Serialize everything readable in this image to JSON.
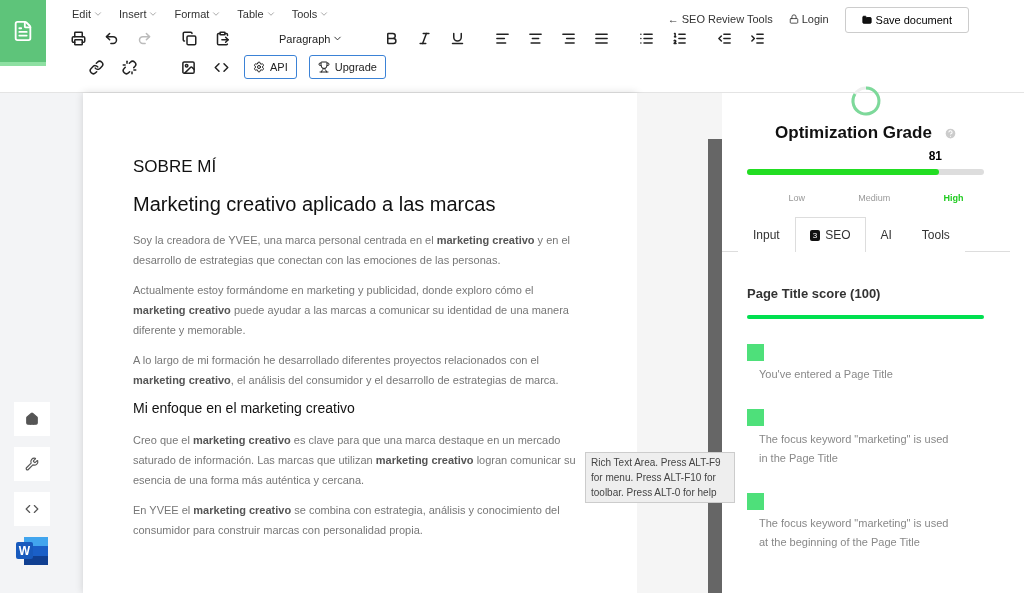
{
  "menus": [
    {
      "label": "Edit"
    },
    {
      "label": "Insert"
    },
    {
      "label": "Format"
    },
    {
      "label": "Table"
    },
    {
      "label": "Tools"
    }
  ],
  "toolbar_row1": [
    {
      "kind": "print",
      "disabled": false
    },
    {
      "kind": "undo",
      "disabled": false
    },
    {
      "kind": "redo",
      "disabled": true
    },
    {
      "kind": "gap"
    },
    {
      "kind": "copy",
      "disabled": false
    },
    {
      "kind": "paste",
      "disabled": false
    },
    {
      "kind": "block",
      "label": "Paragraph"
    },
    {
      "kind": "bold",
      "disabled": false
    },
    {
      "kind": "italic",
      "disabled": false
    },
    {
      "kind": "underline",
      "disabled": false
    },
    {
      "kind": "gap"
    },
    {
      "kind": "align-left",
      "disabled": false
    },
    {
      "kind": "align-center",
      "disabled": false
    },
    {
      "kind": "align-right",
      "disabled": false
    },
    {
      "kind": "align-justify",
      "disabled": false
    },
    {
      "kind": "gap"
    },
    {
      "kind": "bullets",
      "disabled": false
    },
    {
      "kind": "numbers",
      "disabled": false
    },
    {
      "kind": "gap"
    },
    {
      "kind": "outdent",
      "disabled": false
    },
    {
      "kind": "indent",
      "disabled": false
    }
  ],
  "toolbar_row2": [
    {
      "kind": "link",
      "disabled": false
    },
    {
      "kind": "unlink",
      "disabled": false
    },
    {
      "kind": "gap"
    },
    {
      "kind": "image",
      "disabled": false
    },
    {
      "kind": "code",
      "disabled": false
    },
    {
      "kind": "api",
      "label": "API"
    },
    {
      "kind": "upgrade",
      "label": "Upgrade"
    }
  ],
  "top_links": [
    {
      "kind": "back",
      "label": "← SEO Review Tools"
    },
    {
      "kind": "login",
      "label": "Login"
    }
  ],
  "save_button": "Save document",
  "side_buttons": [
    {
      "kind": "home"
    },
    {
      "kind": "wrench"
    },
    {
      "kind": "code"
    },
    {
      "kind": "word",
      "label": "W"
    }
  ],
  "document": [
    {
      "kind": "h3",
      "text": "SOBRE MÍ"
    },
    {
      "kind": "h1",
      "text": "Marketing creativo aplicado a las marcas"
    },
    {
      "kind": "p",
      "text": "Soy la creadora de YVEE, una marca personal centrada en el **marketing creativo** y en el desarrollo de estrategias que conectan con las emociones de las personas."
    },
    {
      "kind": "p",
      "text": "Actualmente estoy formándome en marketing y publicidad, donde exploro cómo el **marketing creativo** puede ayudar a las marcas a comunicar su identidad de una manera diferente y memorable."
    },
    {
      "kind": "p",
      "text": "A lo largo de mi formación he desarrollado diferentes proyectos relacionados con el **marketing creativo**, el análisis del consumidor y el desarrollo de estrategias de marca."
    },
    {
      "kind": "h2",
      "text": "Mi enfoque en el marketing creativo"
    },
    {
      "kind": "p",
      "text": "Creo que el **marketing creativo** es clave para que una marca destaque en un mercado saturado de información. Las marcas que utilizan **marketing creativo** logran comunicar su esencia de una forma más auténtica y cercana."
    },
    {
      "kind": "p",
      "text": "En YVEE el **marketing creativo** se combina con estrategia, análisis y conocimiento del consumidor para construir marcas con personalidad propia."
    }
  ],
  "tooltip": "Rich Text Area. Press ALT-F9 for menu. Press ALT-F10 for toolbar. Press ALT-0 for help",
  "grade": {
    "title": "Optimization Grade",
    "score": "81",
    "level": 0.81,
    "bands": [
      {
        "label": "Low",
        "selected": false
      },
      {
        "label": "Medium",
        "selected": false
      },
      {
        "label": "High",
        "selected": true
      }
    ]
  },
  "tabs": [
    {
      "label": "Input",
      "selected": false
    },
    {
      "label": "SEO",
      "badge": "3",
      "selected": true
    },
    {
      "label": "AI",
      "selected": false
    },
    {
      "label": "Tools",
      "selected": false
    }
  ],
  "section": {
    "title": "Page Title score (100)",
    "level": 1
  },
  "checks": [
    {
      "text": "You've entered a Page Title",
      "color": "#4ee07a"
    },
    {
      "text": "The focus keyword \"marketing\" is used in the Page Title",
      "color": "#4ee07a"
    },
    {
      "text": "The focus keyword \"marketing\" is used at the beginning of the Page Title",
      "color": "#4ee07a"
    }
  ]
}
